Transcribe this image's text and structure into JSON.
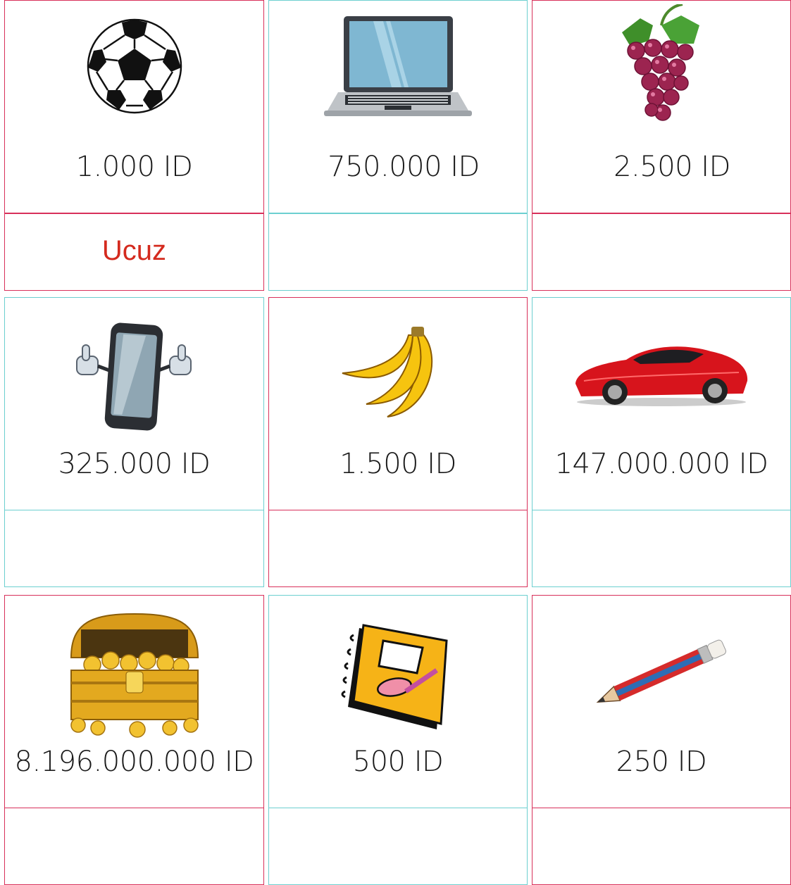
{
  "colors": {
    "pink_border": "#d8305a",
    "teal_border": "#6ccfd0",
    "answer": "#d42a1e"
  },
  "cards": [
    {
      "icon": "soccer-ball-icon",
      "price": "1.000 ID",
      "answer": "Ucuz"
    },
    {
      "icon": "laptop-icon",
      "price": "750.000 ID",
      "answer": ""
    },
    {
      "icon": "grapes-icon",
      "price": "2.500 ID",
      "answer": ""
    },
    {
      "icon": "smartphone-thumbs-up-icon",
      "price": "325.000 ID",
      "answer": ""
    },
    {
      "icon": "bananas-icon",
      "price": "1.500 ID",
      "answer": ""
    },
    {
      "icon": "red-sports-car-icon",
      "price": "147.000.000 ID",
      "answer": ""
    },
    {
      "icon": "treasure-chest-icon",
      "price": "8.196.000.000 ID",
      "answer": ""
    },
    {
      "icon": "notebook-icon",
      "price": "500 ID",
      "answer": ""
    },
    {
      "icon": "pencil-icon",
      "price": "250 ID",
      "answer": ""
    }
  ]
}
